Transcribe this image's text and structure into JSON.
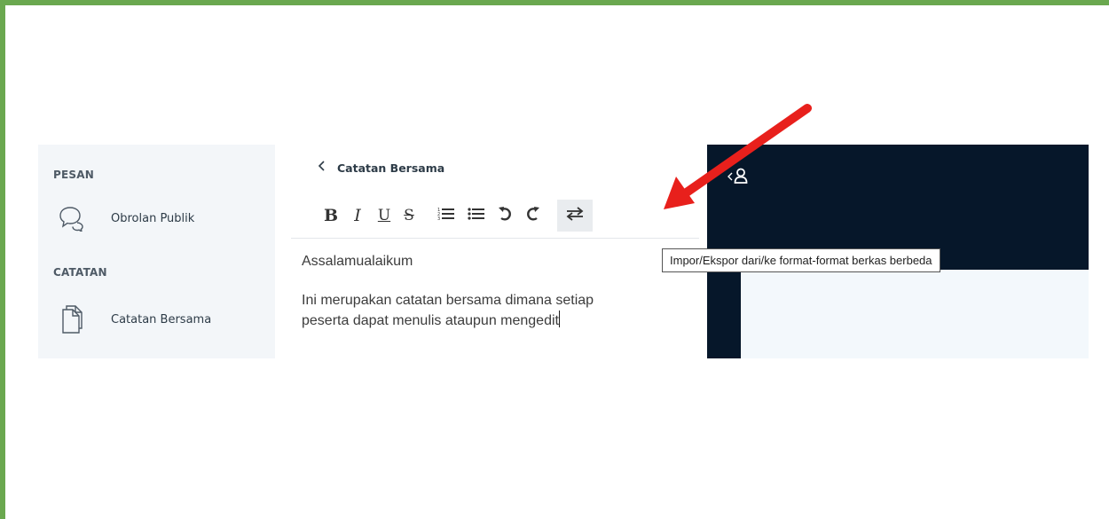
{
  "sidebar": {
    "sections": [
      {
        "label": "PESAN",
        "items": [
          {
            "label": "Obrolan Publik",
            "icon": "chat-bubbles-icon"
          }
        ]
      },
      {
        "label": "CATATAN",
        "items": [
          {
            "label": "Catatan Bersama",
            "icon": "document-icon"
          }
        ]
      }
    ]
  },
  "notes": {
    "title": "Catatan Bersama",
    "toolbar": {
      "bold": "B",
      "italic": "I",
      "underline": "U",
      "strike": "S",
      "ordered_list_icon": "ordered-list-icon",
      "bullet_list_icon": "bullet-list-icon",
      "undo_icon": "undo-icon",
      "redo_icon": "redo-icon",
      "import_export_icon": "import-export-icon"
    },
    "content": {
      "line1": "Assalamualaikum",
      "line2": "Ini merupakan catatan bersama dimana setiap",
      "line3": "peserta dapat menulis ataupun mengedit"
    }
  },
  "tooltip": "Impor/Ekspor dari/ke format-format berkas berbeda",
  "annotation": {
    "color": "#e8201c"
  },
  "colors": {
    "frame": "#6aa84f",
    "sidebar_bg": "#f3f6f9",
    "dark_panel": "#06172a",
    "light_area": "#f3f8fc"
  }
}
